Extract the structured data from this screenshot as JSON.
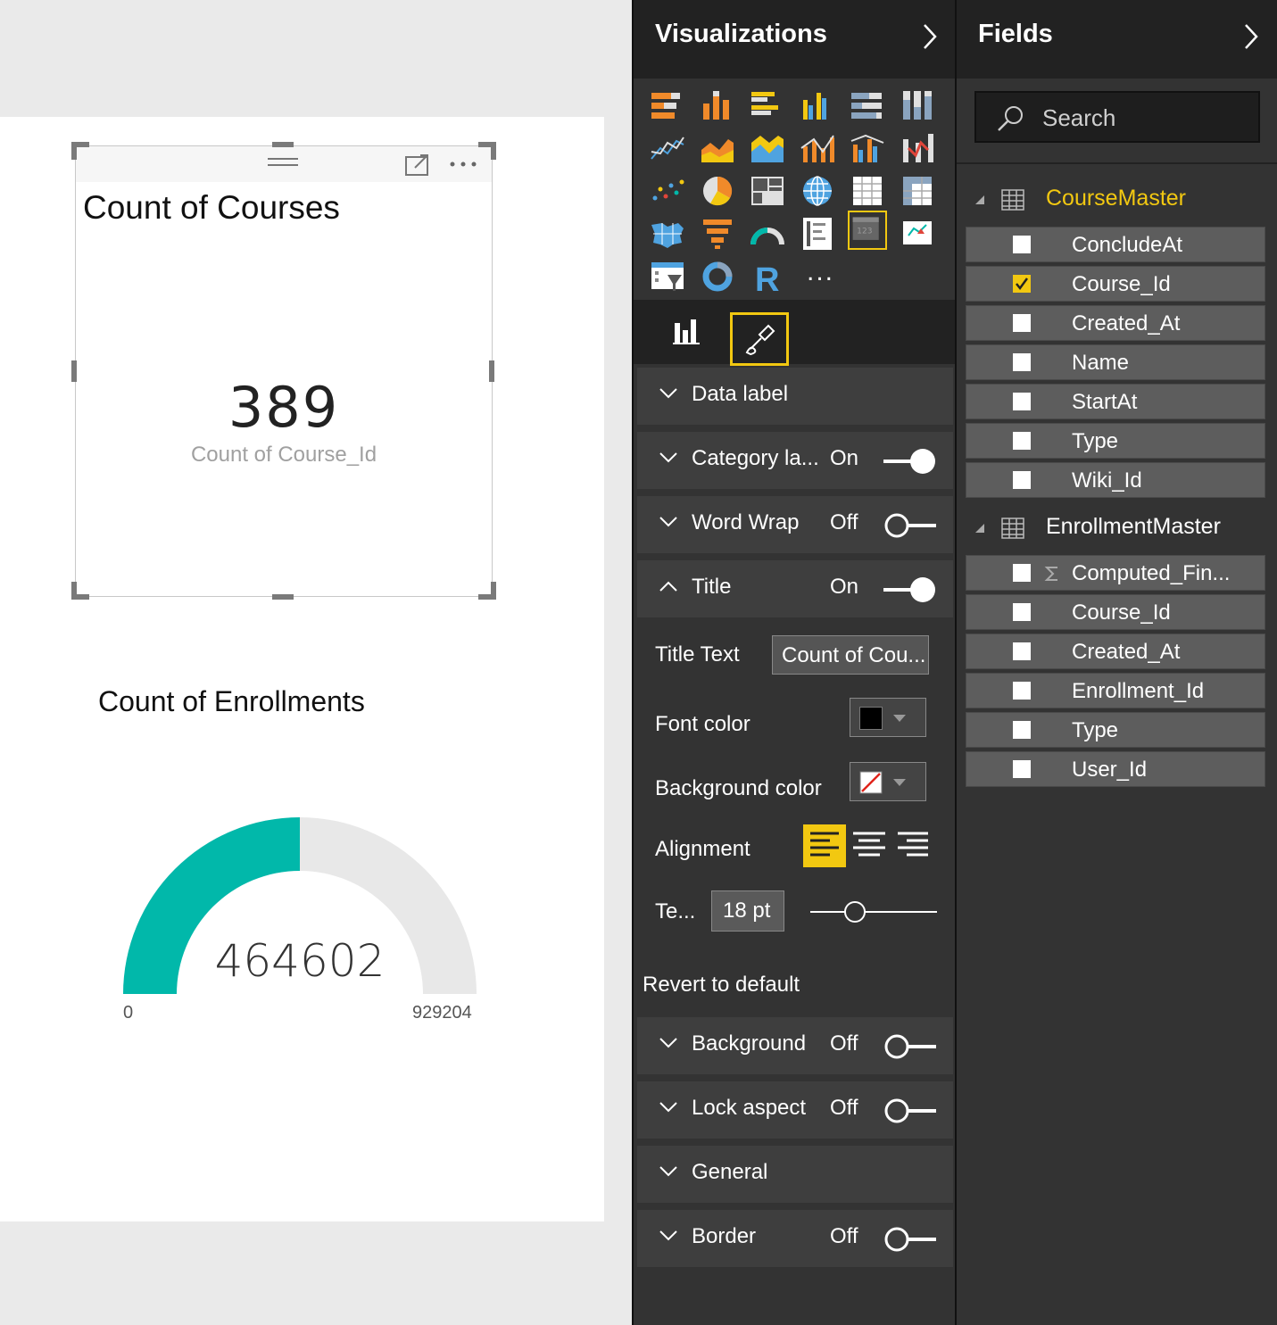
{
  "report": {
    "card": {
      "title": "Count of Courses",
      "value": "389",
      "label": "Count of Course_Id"
    },
    "gauge": {
      "title": "Count of Enrollments",
      "value": "464602",
      "min": "0",
      "max": "929204",
      "fill_color": "#01b8aa",
      "track_color": "#e8e8e8"
    }
  },
  "visualizations_pane": {
    "title": "Visualizations",
    "selected_visual": "card-visual-icon",
    "tabs": [
      "fields-tab",
      "format-tab"
    ],
    "active_tab": "format-tab",
    "sections": {
      "data_label": {
        "label": "Data label"
      },
      "category_label": {
        "label": "Category la...",
        "state": "On"
      },
      "word_wrap": {
        "label": "Word Wrap",
        "state": "Off"
      },
      "title": {
        "label": "Title",
        "state": "On"
      },
      "background": {
        "label": "Background",
        "state": "Off"
      },
      "lock_aspect": {
        "label": "Lock aspect",
        "state": "Off"
      },
      "general": {
        "label": "General"
      },
      "border": {
        "label": "Border",
        "state": "Off"
      }
    },
    "title_props": {
      "title_text_label": "Title Text",
      "title_text_value": "Count of Cou...",
      "font_color_label": "Font color",
      "font_color": "#000000",
      "background_color_label": "Background color",
      "alignment_label": "Alignment",
      "alignment_selected": "left",
      "text_size_label": "Te...",
      "text_size_value": "18  pt",
      "revert_label": "Revert to default"
    },
    "more_label": "..."
  },
  "fields_pane": {
    "title": "Fields",
    "search_placeholder": "Search",
    "tables": [
      {
        "name": "CourseMaster",
        "active": true,
        "fields": [
          {
            "name": "ConcludeAt",
            "checked": false
          },
          {
            "name": "Course_Id",
            "checked": true
          },
          {
            "name": "Created_At",
            "checked": false
          },
          {
            "name": "Name",
            "checked": false
          },
          {
            "name": "StartAt",
            "checked": false
          },
          {
            "name": "Type",
            "checked": false
          },
          {
            "name": "Wiki_Id",
            "checked": false
          }
        ]
      },
      {
        "name": "EnrollmentMaster",
        "active": false,
        "fields": [
          {
            "name": "Computed_Fin...",
            "checked": false,
            "measure": true
          },
          {
            "name": "Course_Id",
            "checked": false
          },
          {
            "name": "Created_At",
            "checked": false
          },
          {
            "name": "Enrollment_Id",
            "checked": false
          },
          {
            "name": "Type",
            "checked": false
          },
          {
            "name": "User_Id",
            "checked": false
          }
        ]
      }
    ]
  },
  "colors": {
    "accent_yellow": "#f2c811",
    "pane_bg": "#333333",
    "header_bg": "#222222"
  }
}
